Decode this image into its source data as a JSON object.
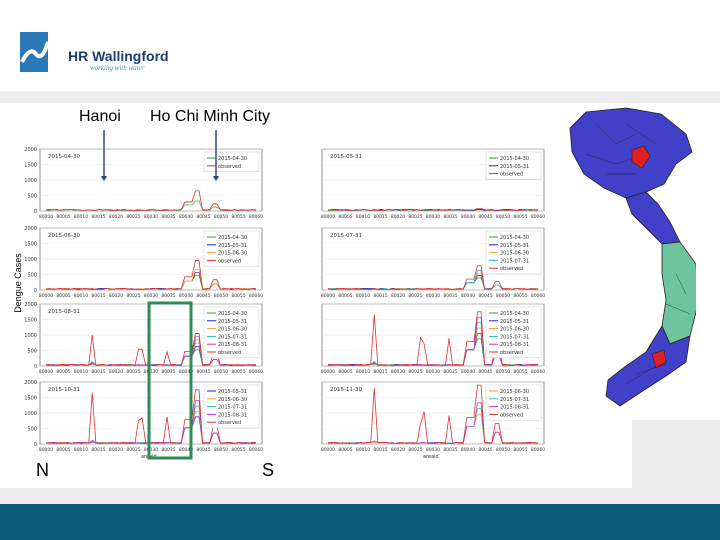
{
  "logo": {
    "name": "HR Wallingford",
    "tagline": "working with water"
  },
  "labels": {
    "hanoi": "Hanoi",
    "hcmc": "Ho Chi Minh City",
    "ylabel": "Dengue Cases",
    "north": "N",
    "south": "S"
  },
  "colors": {
    "footer": "#0a5a7a",
    "highlight_box": "#2e8b57",
    "map_north_south": "#4040c8",
    "map_central": "#6fc4a0",
    "map_cities": "#e02020"
  },
  "chart_data": {
    "type": "line",
    "xlabel": "areaid",
    "categories": [
      "80000",
      "80005",
      "80010",
      "80015",
      "80020",
      "80025",
      "80030",
      "80035",
      "80040",
      "80045",
      "80050",
      "80055",
      "80060"
    ],
    "series_colors": {
      "2015-04-30": "#2ca02c",
      "2015-05-31": "#1f1fd0",
      "2015-06-30": "#ff9f1c",
      "2015-07-31": "#17becf",
      "2015-08-31": "#c030c0",
      "observed": "#e03030"
    },
    "panels": [
      {
        "title": "2015-04-30",
        "ylim": [
          0,
          2000
        ],
        "yticks": [
          0,
          500,
          1000,
          1500,
          2000
        ],
        "legend": [
          "2015-04-30",
          "observed"
        ],
        "peak_obs": 650
      },
      {
        "title": "2015-05-31",
        "ylim": [
          0,
          2000
        ],
        "yticks": [],
        "legend": [
          "2015-04-30",
          "2015-05-31",
          "observed"
        ],
        "peak_obs": 80
      },
      {
        "title": "2015-06-30",
        "ylim": [
          0,
          2000
        ],
        "yticks": [
          0,
          500,
          1000,
          1500,
          2000
        ],
        "legend": [
          "2015-04-30",
          "2015-05-31",
          "2015-06-30",
          "observed"
        ],
        "peak_obs": 950
      },
      {
        "title": "2015-07-31",
        "ylim": [
          0,
          2000
        ],
        "yticks": [],
        "legend": [
          "2015-04-30",
          "2015-05-31",
          "2015-06-30",
          "2015-07-31",
          "observed"
        ],
        "peak_obs": 780
      },
      {
        "title": "2015-08-31",
        "ylim": [
          0,
          2000
        ],
        "yticks": [
          0,
          500,
          1000,
          1500,
          2000
        ],
        "legend": [
          "2015-04-30",
          "2015-05-31",
          "2015-06-30",
          "2015-07-31",
          "2015-08-31",
          "observed"
        ],
        "peak_obs": 1050
      },
      {
        "title": "",
        "ylim": [
          0,
          2000
        ],
        "yticks": [],
        "legend": [
          "2015-04-30",
          "2015-05-31",
          "2015-06-30",
          "2015-07-31",
          "2015-08-31",
          "observed"
        ],
        "peak_obs": 1750
      },
      {
        "title": "2015-10-31",
        "ylim": [
          0,
          2000
        ],
        "yticks": [
          0,
          500,
          1000,
          1500,
          2000
        ],
        "legend": [
          "2015-05-31",
          "2015-06-30",
          "2015-07-31",
          "2015-08-31",
          "observed"
        ],
        "peak_obs": 1750
      },
      {
        "title": "2015-11-30",
        "ylim": [
          0,
          2000
        ],
        "yticks": [],
        "legend": [
          "2015-06-30",
          "2015-07-31",
          "2015-08-31",
          "observed"
        ],
        "peak_obs": 1900
      }
    ]
  }
}
